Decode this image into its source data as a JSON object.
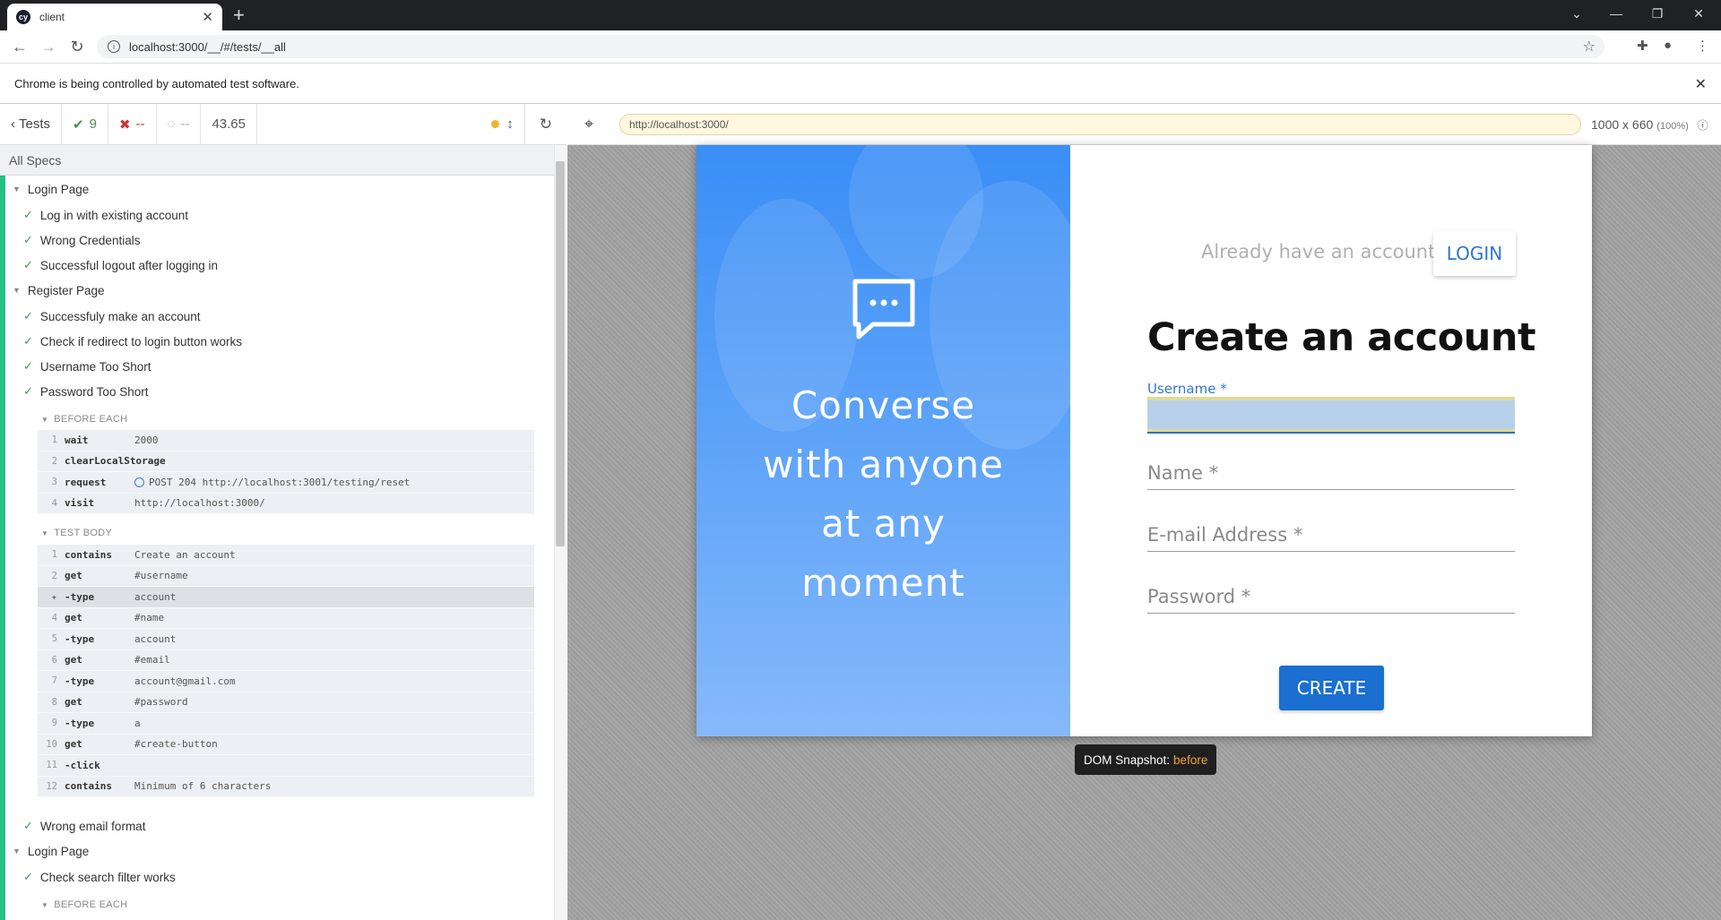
{
  "browser": {
    "tab_title": "client",
    "tab_favicon": "cy",
    "url": "localhost:3000/__/#/tests/__all",
    "infobar_text": "Chrome is being controlled by automated test software."
  },
  "reporter": {
    "tests_label": "Tests",
    "passed": "9",
    "failed": "--",
    "pending": "--",
    "duration": "43.65",
    "all_specs": "All Specs",
    "suites": [
      {
        "title": "Login Page",
        "tests": [
          "Log in with existing account",
          "Wrong Credentials",
          "Successful logout after logging in"
        ]
      },
      {
        "title": "Register Page",
        "tests": [
          "Successfuly make an account",
          "Check if redirect to login button works",
          "Username Too Short",
          "Password Too Short"
        ]
      }
    ],
    "before_each_title": "BEFORE EACH",
    "before_each": [
      {
        "num": "1",
        "name": "wait",
        "msg": "2000"
      },
      {
        "num": "2",
        "name": "clearLocalStorage",
        "msg": ""
      },
      {
        "num": "3",
        "name": "request",
        "msg": "POST 204 http://localhost:3001/testing/reset"
      },
      {
        "num": "4",
        "name": "visit",
        "msg": "http://localhost:3000/"
      }
    ],
    "test_body_title": "TEST BODY",
    "test_body": [
      {
        "num": "1",
        "name": "contains",
        "msg": "Create an account"
      },
      {
        "num": "2",
        "name": "get",
        "msg": "#username"
      },
      {
        "num": "",
        "name": "-type",
        "msg": "account"
      },
      {
        "num": "4",
        "name": "get",
        "msg": "#name"
      },
      {
        "num": "5",
        "name": "-type",
        "msg": "account"
      },
      {
        "num": "6",
        "name": "get",
        "msg": "#email"
      },
      {
        "num": "7",
        "name": "-type",
        "msg": "account@gmail.com"
      },
      {
        "num": "8",
        "name": "get",
        "msg": "#password"
      },
      {
        "num": "9",
        "name": "-type",
        "msg": "a"
      },
      {
        "num": "10",
        "name": "get",
        "msg": "#create-button"
      },
      {
        "num": "11",
        "name": "-click",
        "msg": ""
      },
      {
        "num": "12",
        "name": "contains",
        "msg": "Minimum of 6 characters"
      }
    ],
    "after": {
      "test": "Wrong email format",
      "suite": "Login Page",
      "test2": "Check search filter works",
      "before_each_title": "BEFORE EACH"
    }
  },
  "aut": {
    "url": "http://localhost:3000/",
    "viewport": "1000 x 660",
    "zoom": "(100%)",
    "snapshot_label": "DOM Snapshot:",
    "snapshot_state": "before"
  },
  "app": {
    "hero_text": "Converse\nwith anyone\nat any\nmoment",
    "already_text": "Already have an account?",
    "login_label": "LOGIN",
    "title": "Create an account",
    "username_label": "Username *",
    "name_label": "Name *",
    "email_label": "E-mail Address *",
    "password_label": "Password *",
    "create_label": "CREATE"
  },
  "colors": {
    "pass": "#4a8f4f",
    "fail": "#cc3333",
    "accent": "#1a6fd0",
    "hero": "#3a8ef6"
  }
}
